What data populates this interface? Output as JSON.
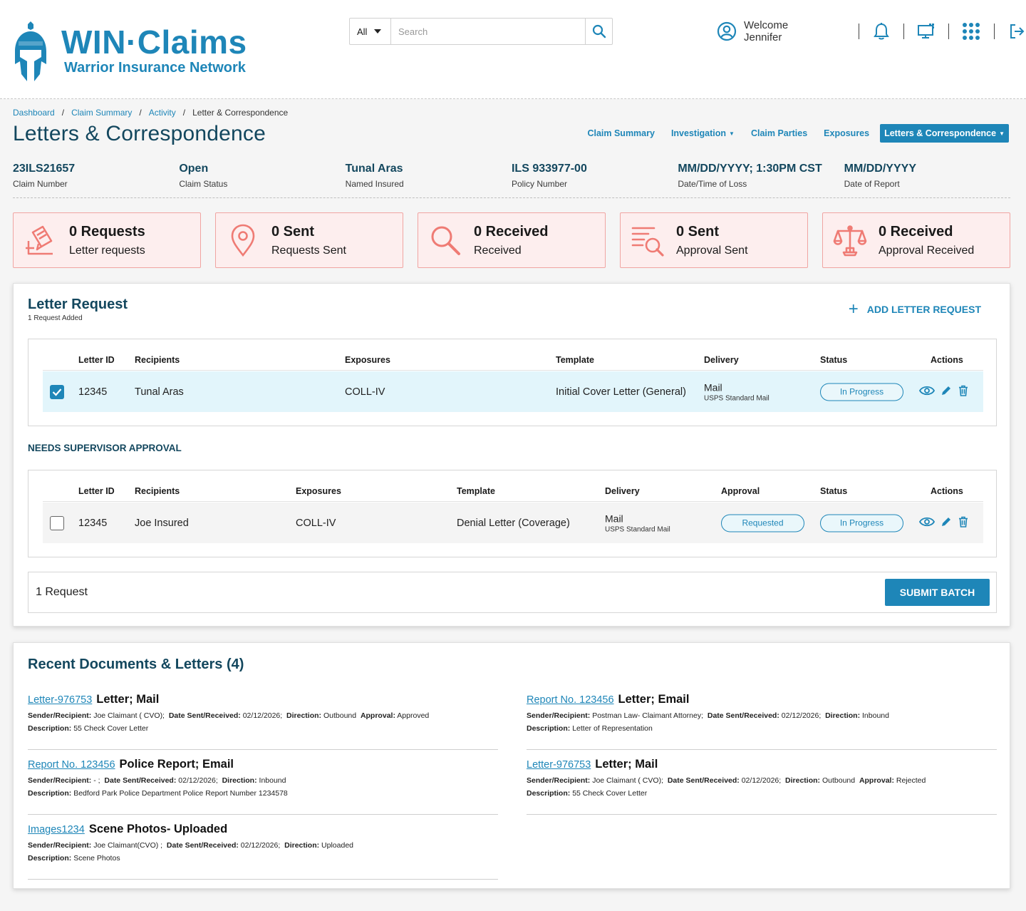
{
  "header": {
    "brand_title": "WIN·Claims",
    "brand_subtitle": "Warrior Insurance Network",
    "search": {
      "scope": "All",
      "placeholder": "Search"
    },
    "welcome": "Welcome Jennifer"
  },
  "breadcrumb": [
    "Dashboard",
    "Claim Summary",
    "Activity",
    "Letter & Correspondence"
  ],
  "page_title": "Letters & Correspondence",
  "nav_tabs": [
    "Claim Summary",
    "Investigation",
    "Claim Parties",
    "Exposures",
    "Letters & Correspondence"
  ],
  "claim_info": [
    {
      "value": "23ILS21657",
      "label": "Claim Number"
    },
    {
      "value": "Open",
      "label": "Claim Status"
    },
    {
      "value": "Tunal Aras",
      "label": "Named Insured"
    },
    {
      "value": "ILS 933977-00",
      "label": "Policy Number"
    },
    {
      "value": "MM/DD/YYYY; 1:30PM CST",
      "label": "Date/Time of Loss"
    },
    {
      "value": "MM/DD/YYYY",
      "label": "Date of Report"
    }
  ],
  "stats": [
    {
      "count": "0 Requests",
      "label": "Letter requests",
      "icon": "edit-document-icon"
    },
    {
      "count": "0 Sent",
      "label": "Requests Sent",
      "icon": "location-pin-icon"
    },
    {
      "count": "0 Received",
      "label": "Received",
      "icon": "search-icon"
    },
    {
      "count": "0 Sent",
      "label": "Approval Sent",
      "icon": "list-search-icon"
    },
    {
      "count": "0 Received",
      "label": "Approval Received",
      "icon": "scales-icon"
    }
  ],
  "letter_request": {
    "title": "Letter Request",
    "subtitle": "1 Request Added",
    "add_label": "ADD LETTER REQUEST",
    "columns": [
      "Letter ID",
      "Recipients",
      "Exposures",
      "Template",
      "Delivery",
      "Status",
      "Actions"
    ],
    "rows": [
      {
        "letter_id": "12345",
        "recipients": "Tunal Aras",
        "exposures": "COLL-IV",
        "template": "Initial Cover Letter (General)",
        "delivery": "Mail",
        "delivery_sub": "USPS Standard Mail",
        "status": "In Progress",
        "checked": true
      }
    ]
  },
  "approval": {
    "title": "NEEDS SUPERVISOR APPROVAL",
    "columns": [
      "Letter ID",
      "Recipients",
      "Exposures",
      "Template",
      "Delivery",
      "Approval",
      "Status",
      "Actions"
    ],
    "rows": [
      {
        "letter_id": "12345",
        "recipients": "Joe Insured",
        "exposures": "COLL-IV",
        "template": "Denial Letter (Coverage)",
        "delivery": "Mail",
        "delivery_sub": "USPS Standard Mail",
        "approval": "Requested",
        "status": "In Progress",
        "checked": false
      }
    ]
  },
  "batch": {
    "count": "1 Request",
    "submit_label": "SUBMIT BATCH"
  },
  "recent_docs": {
    "title": "Recent Documents & Letters (4)",
    "labels": {
      "sender": "Sender/Recipient:",
      "date": "Date Sent/Received:",
      "direction": "Direction:",
      "approval": "Approval:",
      "description": "Description:"
    },
    "left": [
      {
        "link": "Letter-976753",
        "type": "Letter; Mail",
        "sender": "Joe Claimant ( CVO);",
        "date": "02/12/2026;",
        "direction": "Outbound",
        "approval": "Approved",
        "description": "55 Check Cover Letter"
      },
      {
        "link": "Report No. 123456",
        "type": "Police Report; Email",
        "sender": "- ;",
        "date": "02/12/2026;",
        "direction": "Inbound",
        "approval": "",
        "description": "Bedford Park Police Department Police Report Number 1234578"
      },
      {
        "link": "Images1234",
        "type": "Scene Photos- Uploaded",
        "sender": "Joe Claimant(CVO) ;",
        "date": "02/12/2026;",
        "direction": "Uploaded",
        "approval": "",
        "description": "Scene Photos"
      }
    ],
    "right": [
      {
        "link": "Report No. 123456",
        "type": "Letter; Email",
        "sender": "Postman Law- Claimant Attorney;",
        "date": "02/12/2026;",
        "direction": "Inbound",
        "approval": "",
        "description": "Letter of Representation"
      },
      {
        "link": "Letter-976753",
        "type": "Letter; Mail",
        "sender": "Joe Claimant ( CVO);",
        "date": "02/12/2026;",
        "direction": "Outbound",
        "approval": "Rejected",
        "description": "55 Check Cover Letter"
      }
    ]
  },
  "colors": {
    "primary": "#1e86b8",
    "heading": "#13475e",
    "card_bg": "#fdeeee",
    "card_border": "#f0a5a2",
    "card_icon": "#ef7b74",
    "row_selected": "#e2f5fb"
  }
}
